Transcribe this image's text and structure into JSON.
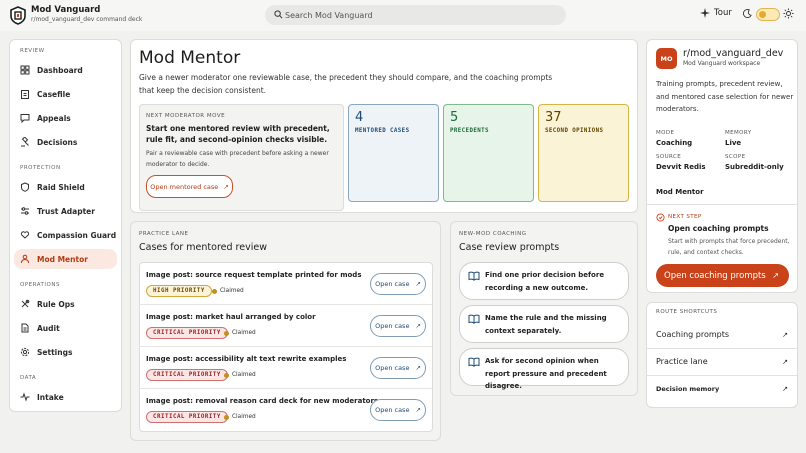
{
  "app": {
    "title": "Mod Vanguard",
    "subtitle": "r/mod_vanguard_dev command deck"
  },
  "search": {
    "placeholder": "Search Mod Vanguard"
  },
  "header": {
    "tour_label": "Tour"
  },
  "sidebar": {
    "sections": [
      {
        "label": "REVIEW",
        "items": [
          "Dashboard",
          "Casefile",
          "Appeals",
          "Decisions"
        ]
      },
      {
        "label": "PROTECTION",
        "items": [
          "Raid Shield",
          "Trust Adapter",
          "Compassion Guard",
          "Mod Mentor"
        ]
      },
      {
        "label": "OPERATIONS",
        "items": [
          "Rule Ops",
          "Audit",
          "Settings"
        ]
      },
      {
        "label": "DATA",
        "items": [
          "Intake"
        ]
      }
    ],
    "active": "Mod Mentor"
  },
  "main": {
    "title": "Mod Mentor",
    "lede": "Give a newer moderator one reviewable case, the precedent they should compare, and the coaching prompts that keep the decision consistent.",
    "next_move": {
      "overline": "NEXT MODERATOR MOVE",
      "headline": "Start one mentored review with precedent, rule fit, and second-opinion checks visible.",
      "body": "Pair a reviewable case with precedent before asking a newer moderator to decide.",
      "button": "Open mentored case"
    },
    "stats": [
      {
        "value": "4",
        "label": "MENTORED CASES"
      },
      {
        "value": "5",
        "label": "PRECEDENTS"
      },
      {
        "value": "37",
        "label": "SECOND OPINIONS"
      }
    ],
    "practice": {
      "overline": "PRACTICE LANE",
      "title": "Cases for mentored review",
      "open_label": "Open case",
      "cases": [
        {
          "title": "Image post: source request template printed for mods",
          "priority": "HIGH PRIORITY",
          "status": "Claimed"
        },
        {
          "title": "Image post: market haul arranged by color",
          "priority": "CRITICAL PRIORITY",
          "status": "Claimed"
        },
        {
          "title": "Image post: accessibility alt text rewrite examples",
          "priority": "CRITICAL PRIORITY",
          "status": "Claimed"
        },
        {
          "title": "Image post: removal reason card deck for new moderators",
          "priority": "CRITICAL PRIORITY",
          "status": "Claimed"
        }
      ]
    },
    "coaching": {
      "overline": "NEW-MOD COACHING",
      "title": "Case review prompts",
      "prompts": [
        "Find one prior decision before recording a new outcome.",
        "Name the rule and the missing context separately.",
        "Ask for second opinion when report pressure and precedent disagree."
      ]
    }
  },
  "workspace": {
    "avatar": "MO",
    "name": "r/mod_vanguard_dev",
    "sub": "Mod Vanguard workspace",
    "description": "Training prompts, precedent review, and mentored case selection for newer moderators.",
    "meta": [
      {
        "label": "MODE",
        "value": "Coaching"
      },
      {
        "label": "MEMORY",
        "value": "Live"
      },
      {
        "label": "SOURCE",
        "value": "Devvit Redis"
      },
      {
        "label": "SCOPE",
        "value": "Subreddit-only"
      }
    ],
    "section": "Mod Mentor",
    "next_step": {
      "overline": "NEXT STEP",
      "title": "Open coaching prompts",
      "body": "Start with prompts that force precedent, rule, and context checks.",
      "button": "Open coaching prompts"
    }
  },
  "shortcuts": {
    "overline": "ROUTE SHORTCUTS",
    "items": [
      "Coaching prompts",
      "Practice lane",
      "Decision memory"
    ]
  },
  "colors": {
    "accent": "#c9421a",
    "active_bg": "#fbe9e1"
  }
}
